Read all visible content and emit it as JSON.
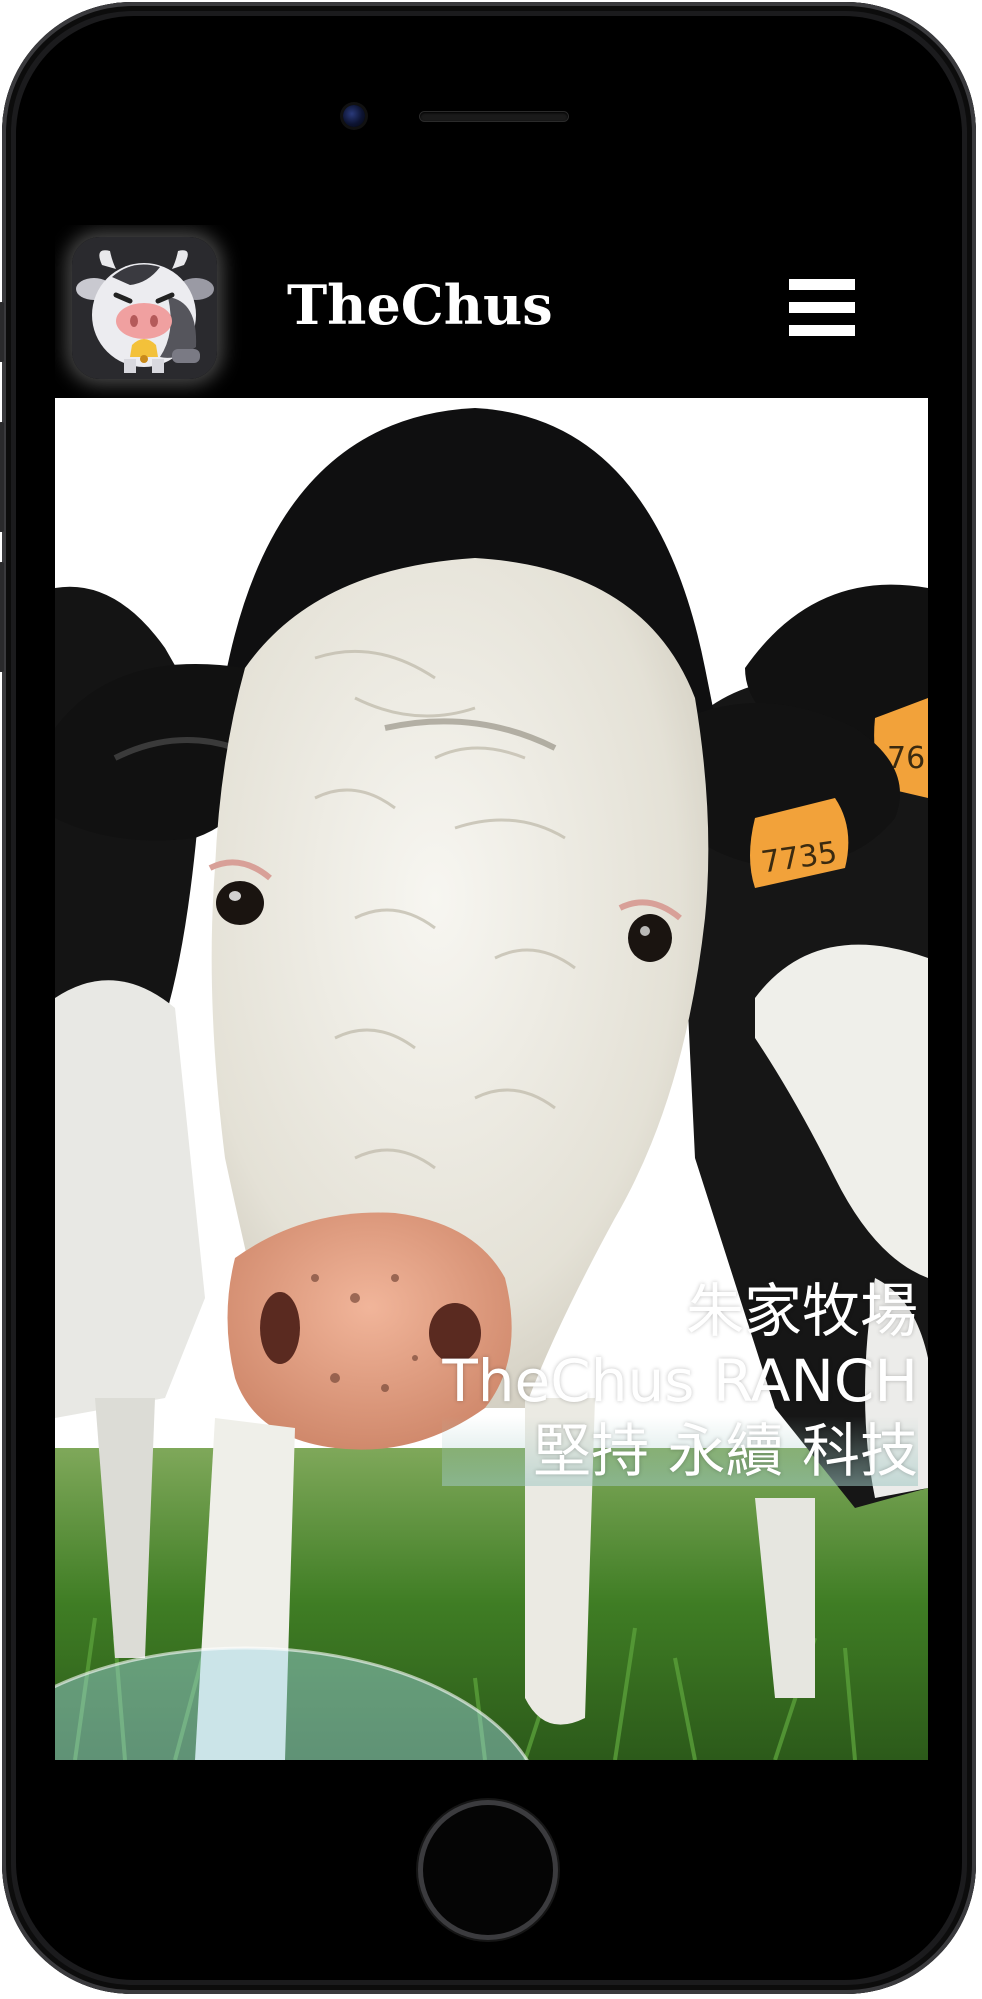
{
  "app": {
    "brand_name": "TheChus",
    "logo_icon": "cow-mascot-logo",
    "menu_icon": "hamburger-menu-icon"
  },
  "hero": {
    "line1": "朱家牧場",
    "line2": "TheChus RANCH",
    "line3": "堅持 永續 科技",
    "ear_tag_main": "7735",
    "ear_tag_side": "76"
  },
  "colors": {
    "background": "#000000",
    "header_text": "#ffffff",
    "ear_tag": "#f2a23a",
    "grass": "#4f8f2c"
  }
}
